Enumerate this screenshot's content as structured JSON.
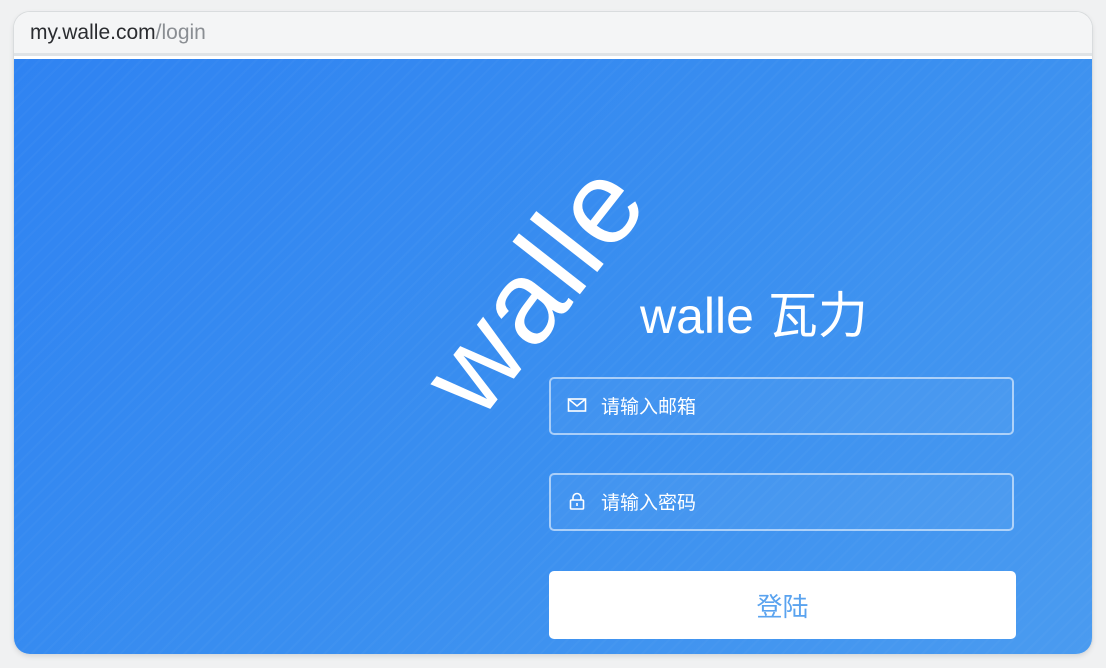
{
  "browser": {
    "url_domain": "my.walle.com",
    "url_path": "/login"
  },
  "login": {
    "logo_mark": "walle",
    "title": "walle 瓦力",
    "email_placeholder": "请输入邮箱",
    "email_icon": "mail-icon",
    "password_placeholder": "请输入密码",
    "password_icon": "lock-icon",
    "submit_label": "登陆"
  },
  "colors": {
    "background_start": "#2f83f2",
    "background_end": "#4a9bf0",
    "button_text": "#5aa3ef"
  }
}
